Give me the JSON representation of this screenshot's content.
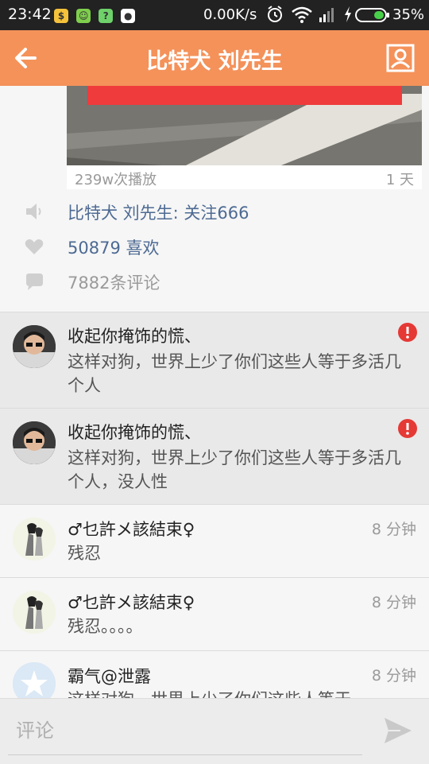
{
  "status_bar": {
    "time": "23:42",
    "network_speed": "0.00K/s",
    "battery": "35%",
    "icons": [
      "notification-app-icon",
      "alarm-icon",
      "wifi-icon",
      "signal-icon",
      "charging-icon",
      "battery-icon"
    ]
  },
  "header": {
    "title": "比特犬 刘先生",
    "back_icon": "back-arrow-icon",
    "profile_icon": "profile-card-icon",
    "color": "#f4925a"
  },
  "video": {
    "plays": "239w次播放",
    "age": "1 天"
  },
  "stats": {
    "author_line": "比特犬 刘先生: 关注666",
    "likes": "50879 喜欢",
    "comments_count": "7882条评论"
  },
  "comments": [
    {
      "name": "收起你掩饰的慌、",
      "text": "这样对狗，世界上少了你们这些人等于多活几个人",
      "time": "",
      "flagged": true
    },
    {
      "name": "收起你掩饰的慌、",
      "text": "这样对狗，世界上少了你们这些人等于多活几个人，没人性",
      "time": "",
      "flagged": true
    },
    {
      "name": "♂乜許メ該結束♀",
      "text": "残忍",
      "time": "8 分钟",
      "flagged": false
    },
    {
      "name": "♂乜許メ該結束♀",
      "text": "残忍。。。。",
      "time": "8 分钟",
      "flagged": false
    },
    {
      "name": "霸气@泄露",
      "text": "这样对狗，世界上少了你们这些人等于",
      "time": "8 分钟",
      "flagged": false
    }
  ],
  "input": {
    "placeholder": "评论",
    "value": ""
  }
}
